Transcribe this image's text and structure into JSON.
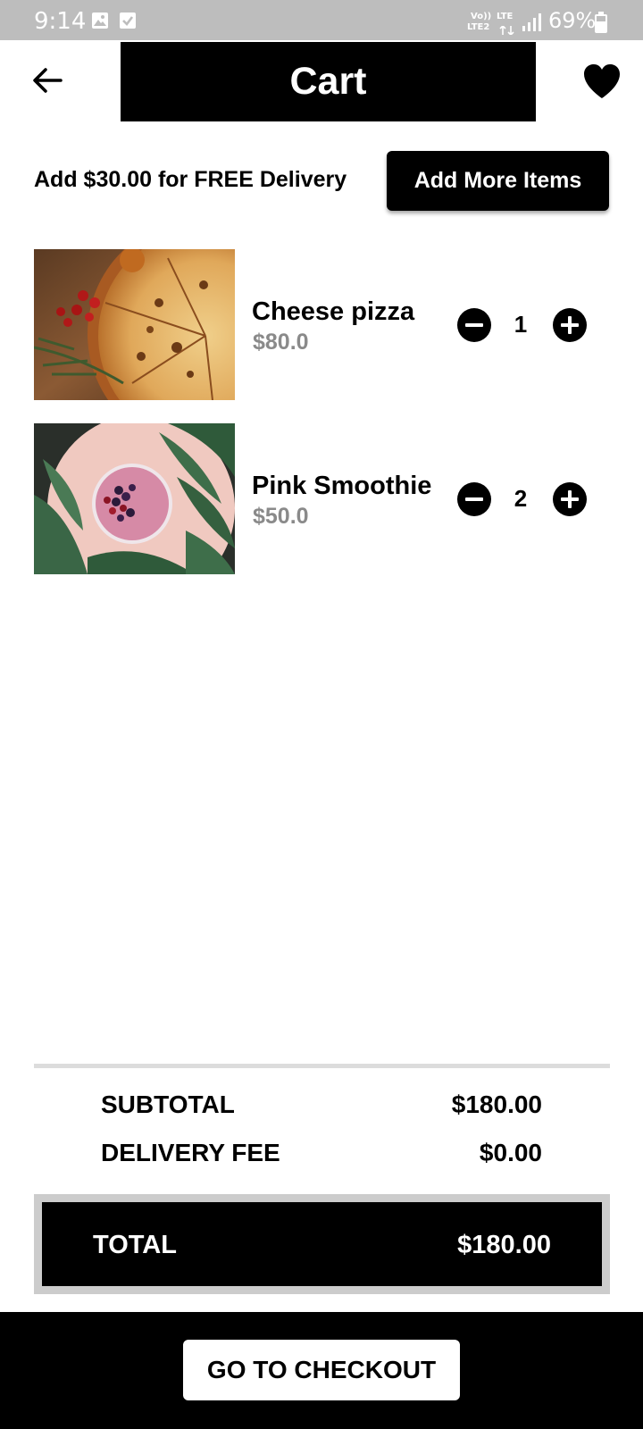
{
  "status_bar": {
    "time": "9:14",
    "volte_label": "Vo))",
    "lte2_label": "LTE2",
    "lte_label": "LTE",
    "battery": "69%",
    "icons": [
      "image-icon",
      "check-box-icon",
      "signal-icon",
      "battery-icon"
    ]
  },
  "header": {
    "title": "Cart",
    "icons": [
      "arrow-left-icon",
      "heart-icon"
    ]
  },
  "delivery": {
    "message": "Add $30.00 for FREE Delivery",
    "add_more_label": "Add More Items"
  },
  "cart": {
    "items": [
      {
        "name": "Cheese pizza",
        "price": "$80.0",
        "quantity": "1"
      },
      {
        "name": "Pink Smoothie",
        "price": "$50.0",
        "quantity": "2"
      }
    ]
  },
  "summary": {
    "subtotal_label": "SUBTOTAL",
    "subtotal_value": "$180.00",
    "delivery_fee_label": "DELIVERY FEE",
    "delivery_fee_value": "$0.00",
    "total_label": "TOTAL",
    "total_value": "$180.00"
  },
  "footer": {
    "checkout_label": "GO TO CHECKOUT"
  },
  "colors": {
    "primary": "#000000",
    "status_bar": "#bdbdbd",
    "price_gray": "#8a8a8a",
    "total_frame": "#cccccc"
  }
}
